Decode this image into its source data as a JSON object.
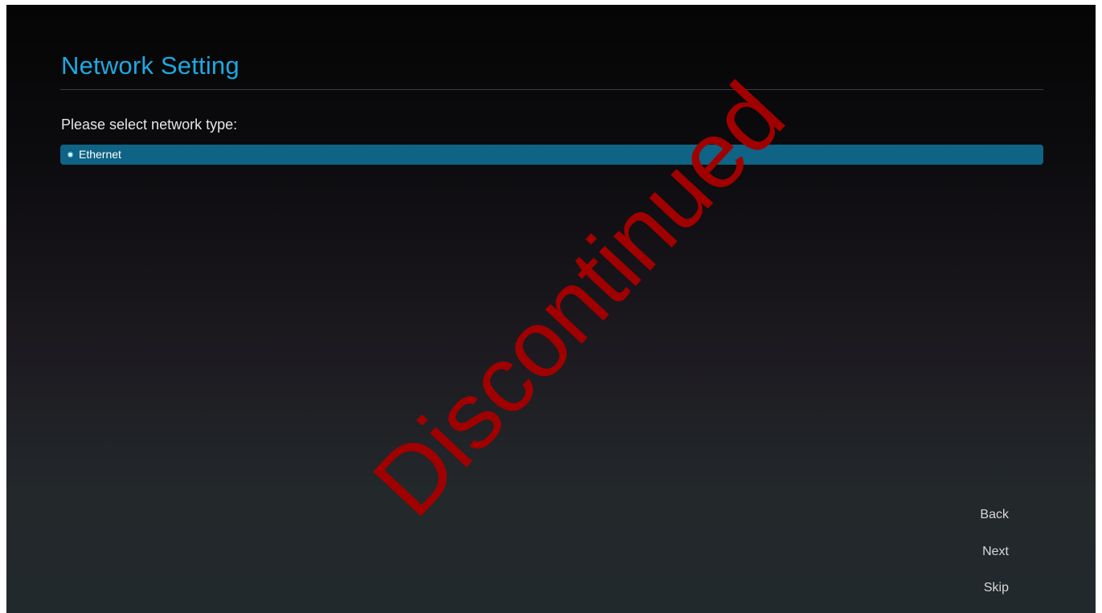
{
  "page": {
    "title": "Network Setting",
    "prompt": "Please select network type:"
  },
  "network_options": [
    {
      "label": "Ethernet",
      "selected": true
    }
  ],
  "navigation": {
    "back_label": "Back",
    "next_label": "Next",
    "skip_label": "Skip"
  },
  "watermark": {
    "text": "Discontinued"
  },
  "colors": {
    "title_accent": "#1ea8e2",
    "selected_row": "#0f6384",
    "watermark": "#a10000"
  }
}
